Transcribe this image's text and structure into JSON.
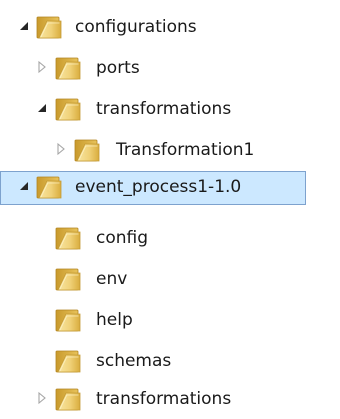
{
  "tree": {
    "nodes": [
      {
        "label": "configurations",
        "expander": "expanded",
        "selected": false
      },
      {
        "label": "ports",
        "expander": "collapsed",
        "selected": false
      },
      {
        "label": "transformations",
        "expander": "expanded",
        "selected": false
      },
      {
        "label": "Transformation1",
        "expander": "collapsed",
        "selected": false
      },
      {
        "label": "event_process1-1.0",
        "expander": "expanded",
        "selected": true
      },
      {
        "label": "config",
        "expander": "none",
        "selected": false
      },
      {
        "label": "env",
        "expander": "none",
        "selected": false
      },
      {
        "label": "help",
        "expander": "none",
        "selected": false
      },
      {
        "label": "schemas",
        "expander": "none",
        "selected": false
      },
      {
        "label": "transformations",
        "expander": "collapsed",
        "selected": false
      }
    ]
  },
  "icons": {
    "folder": "folder-icon",
    "expanded": "expanded-triangle-icon",
    "collapsed": "collapsed-triangle-icon"
  },
  "colors": {
    "selection_fill": "#cce8ff",
    "selection_border": "#7da2ce",
    "folder_yellow": "#e8c04a"
  }
}
